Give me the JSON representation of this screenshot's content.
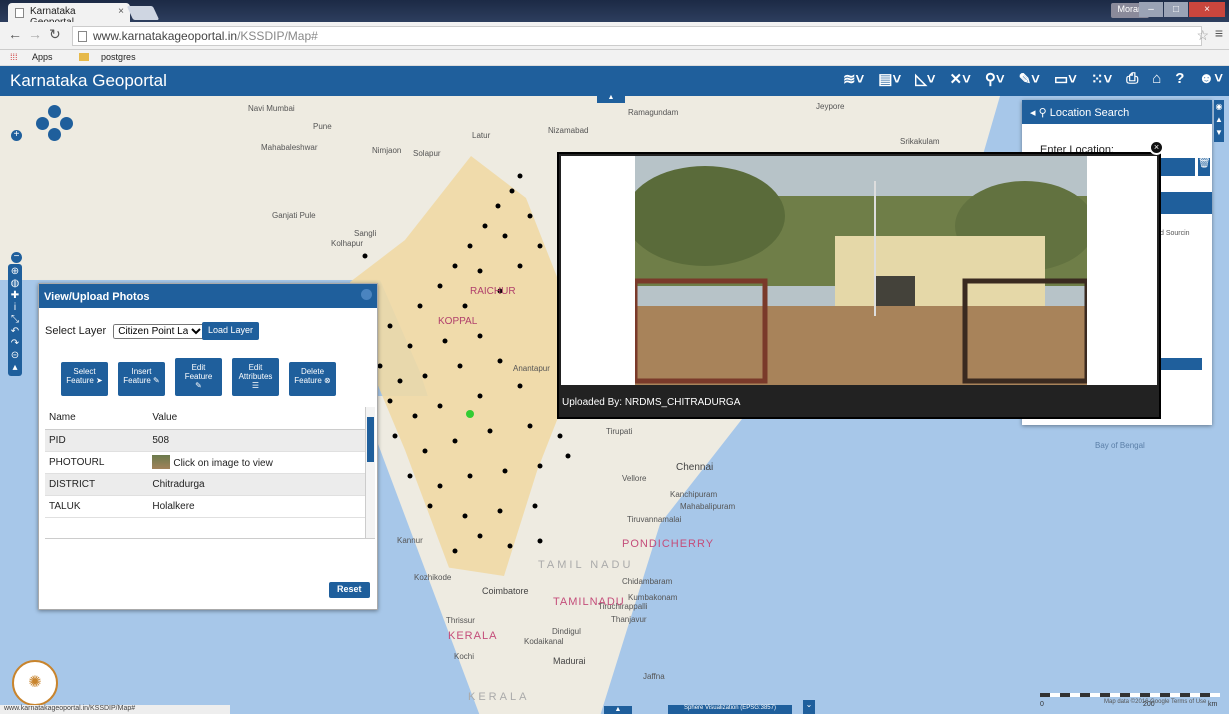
{
  "browser": {
    "tab_title": "Karnataka Geoportal",
    "tab_close": "×",
    "url_domain": "www.karnatakageoportal.in",
    "url_path": "/KSSDIP/Map#",
    "window_user": "Moran",
    "bookmarks": [
      "Apps",
      "postgres"
    ],
    "status_url": "www.karnatakageoportal.in/KSSDIP/Map#"
  },
  "app": {
    "title": "Karnataka Geoportal",
    "toolbar_icons": [
      "layers-icon",
      "document-icon",
      "measure-icon",
      "tools-icon",
      "search-icon",
      "edit-icon",
      "monitor-icon",
      "grid-icon",
      "print-icon",
      "home-icon",
      "help-icon",
      "user-icon"
    ]
  },
  "map": {
    "labels": [
      "Navi Mumbai",
      "Pune",
      "Latur",
      "Nizamabad",
      "Ramagundam",
      "Jeypore",
      "Srikakulam",
      "Mahabaleshwar",
      "Nimjaon",
      "Solapur",
      "Ganjati Pule",
      "Sangli",
      "Kolhapur",
      "RAICHUR",
      "KOPPAL",
      "Anantapur",
      "Tirupati",
      "Vellore",
      "Chennai",
      "Kanchipuram",
      "Mahabalipuram",
      "Tiruvannamalai",
      "Kozhikode",
      "Coimbatore",
      "Chidambaram",
      "Kumbakonam",
      "Tiruchirappalli",
      "Thanjavur",
      "Thrissur",
      "Dindigul",
      "Kodaikanal",
      "Kochi",
      "Madurai",
      "Jaffna",
      "Kannur",
      "Bay of Bengal"
    ],
    "region_labels": [
      "PONDICHERRY",
      "TAMIL NADU",
      "TAMILNADU",
      "KERALA",
      "KERALA"
    ],
    "attribution": "Map data ©2016 Google  Terms of Use",
    "scale_labels": [
      "0",
      "200",
      "km"
    ],
    "projection": "Sphere Visualization (EPSG:3857)"
  },
  "photos_panel": {
    "title": "View/Upload Photos",
    "select_layer_label": "Select Layer",
    "select_layer_value": "Citizen Point Laye",
    "load_layer_label": "Load Layer",
    "actions": [
      {
        "line1": "Select",
        "line2": "Feature ➤"
      },
      {
        "line1": "Insert",
        "line2": "Feature ✎"
      },
      {
        "line1": "Edit",
        "line2": "Feature"
      },
      {
        "line1": "Edit",
        "line2": "Attributes"
      },
      {
        "line1": "Delete",
        "line2": "Feature ⊗"
      }
    ],
    "columns": [
      "Name",
      "Value"
    ],
    "rows": [
      {
        "name": "PID",
        "value": "508"
      },
      {
        "name": "PHOTOURL",
        "value": "Click on image to view"
      },
      {
        "name": "DISTRICT",
        "value": "Chitradurga"
      },
      {
        "name": "TALUK",
        "value": "Holalkere"
      }
    ],
    "reset_label": "Reset"
  },
  "location_search": {
    "title": "Location Search",
    "enter_location_label": "Enter Location:",
    "source_fragment": "d Sourcin"
  },
  "photo_popup": {
    "uploaded_by": "Uploaded By: NRDMS_CHITRADURGA",
    "close": "×"
  },
  "colors": {
    "brand": "#1f5f9c",
    "sea": "#a7c7e9",
    "land": "#eeebe1",
    "state": "#f0d9a5"
  }
}
